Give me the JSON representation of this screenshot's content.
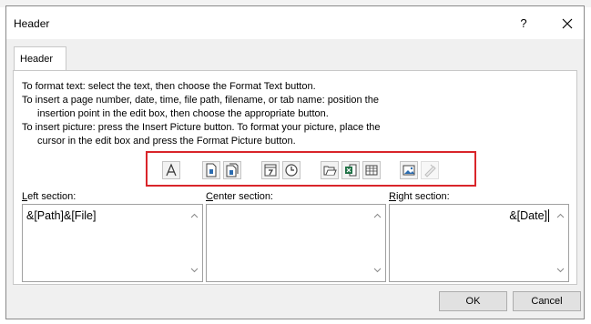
{
  "dialog": {
    "title": "Header",
    "help_label": "?"
  },
  "tab": {
    "label": "Header"
  },
  "instructions": [
    {
      "text": "To format text:  select the text, then choose the Format Text button.",
      "indent": false
    },
    {
      "text": "To insert a page number, date, time, file path, filename, or tab name:  position the",
      "indent": false
    },
    {
      "text": "insertion point in the edit box, then choose the appropriate button.",
      "indent": true
    },
    {
      "text": "To insert picture: press the Insert Picture button.  To format your picture, place the",
      "indent": false
    },
    {
      "text": "cursor in the edit box and press the Format Picture button.",
      "indent": true
    }
  ],
  "toolbar": {
    "highlight_color": "#d9252a",
    "buttons": [
      {
        "icon": "format-text-icon",
        "enabled": true
      },
      {
        "icon": "insert-page-number-icon",
        "enabled": true
      },
      {
        "icon": "insert-number-of-pages-icon",
        "enabled": true
      },
      {
        "icon": "insert-date-icon",
        "enabled": true
      },
      {
        "icon": "insert-time-icon",
        "enabled": true
      },
      {
        "icon": "insert-file-path-icon",
        "enabled": true
      },
      {
        "icon": "insert-file-name-icon",
        "enabled": true
      },
      {
        "icon": "insert-sheet-name-icon",
        "enabled": true
      },
      {
        "icon": "insert-picture-icon",
        "enabled": true
      },
      {
        "icon": "format-picture-icon",
        "enabled": false
      }
    ]
  },
  "sections": {
    "left": {
      "label_key": "L",
      "label_rest": "eft section:",
      "value": "&[Path]&[File]"
    },
    "center": {
      "label_key": "C",
      "label_rest": "enter section:",
      "value": ""
    },
    "right": {
      "label_key": "R",
      "label_rest": "ight section:",
      "value": "&[Date]"
    }
  },
  "buttons": {
    "ok": "OK",
    "cancel": "Cancel"
  }
}
